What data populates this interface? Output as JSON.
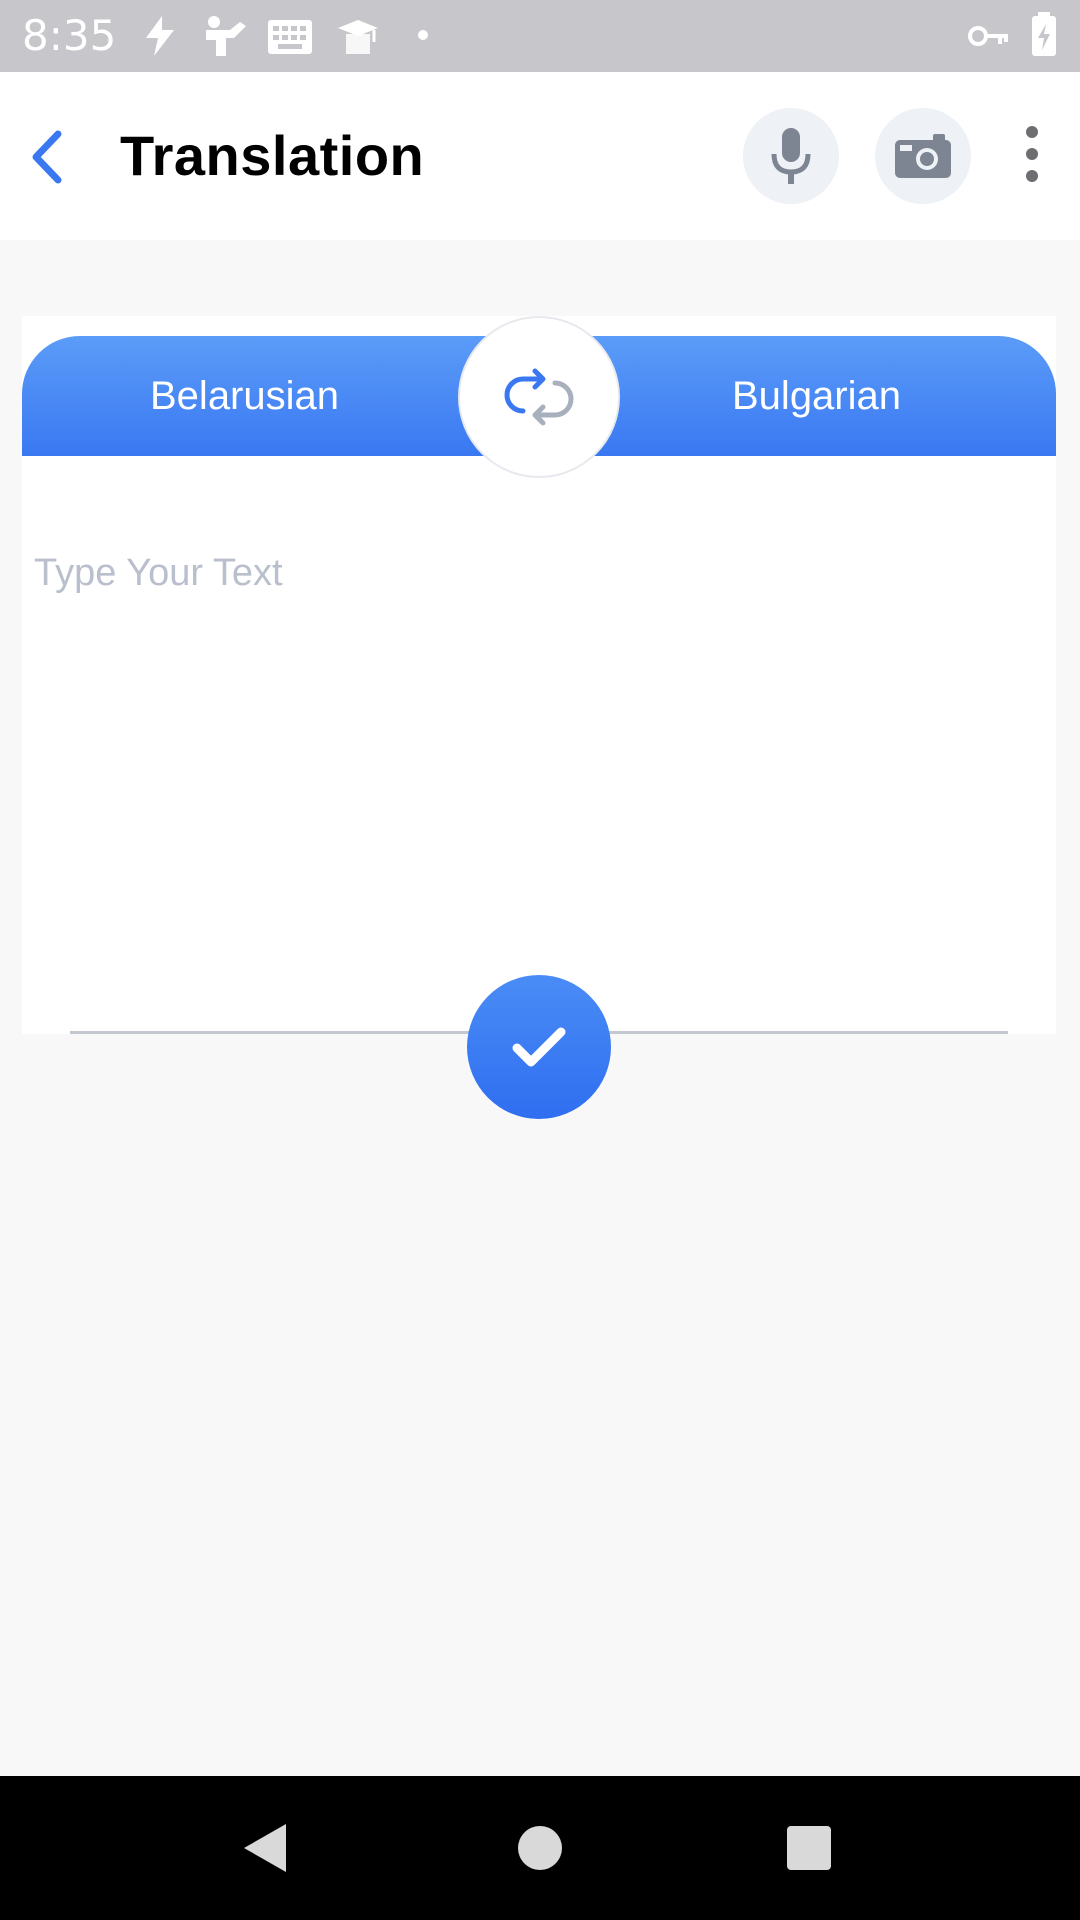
{
  "status_bar": {
    "time": "8:35",
    "icons": [
      "flash-icon",
      "fitness-icon",
      "keyboard-icon",
      "graduation-cap-icon",
      "dot-icon",
      "key-icon",
      "battery-charging-icon"
    ]
  },
  "app_bar": {
    "back_icon": "chevron-left-icon",
    "title": "Translation",
    "mic_icon": "microphone-icon",
    "camera_icon": "camera-icon",
    "more_icon": "more-vertical-icon"
  },
  "translator": {
    "source_language": "Belarusian",
    "target_language": "Bulgarian",
    "swap_icon": "swap-icon",
    "input_placeholder": "Type Your Text",
    "input_value": "",
    "confirm_icon": "check-icon"
  },
  "nav_bar": {
    "back_icon": "nav-back-icon",
    "home_icon": "nav-home-icon",
    "recents_icon": "nav-recents-icon"
  },
  "colors": {
    "accent": "#3a78f2",
    "accent_light": "#5b9cf8",
    "status_bar": "#c7c7cb",
    "background": "#f8f8f9",
    "placeholder": "#b9bfcc"
  }
}
